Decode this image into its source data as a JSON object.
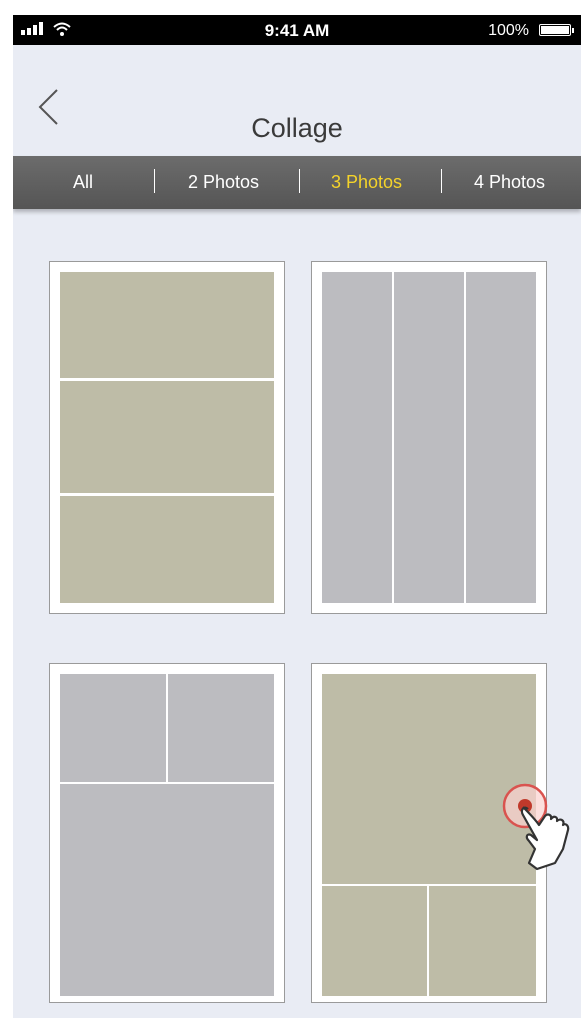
{
  "status_bar": {
    "time": "9:41 AM",
    "battery_text": "100%"
  },
  "header": {
    "title": "Collage",
    "back_icon": "chevron-left-icon"
  },
  "tabs": [
    {
      "label": "All",
      "active": false
    },
    {
      "label": "2 Photos",
      "active": false
    },
    {
      "label": "3 Photos",
      "active": true
    },
    {
      "label": "4 Photos",
      "active": false
    }
  ],
  "colors": {
    "active_tab": "#f4d32a",
    "olive_placeholder": "#bebca7",
    "gray_placeholder": "#bcbcc0",
    "background": "#e9ecf4"
  },
  "templates": [
    {
      "id": "three-horizontal-strips",
      "color": "olive"
    },
    {
      "id": "three-vertical-strips",
      "color": "gray"
    },
    {
      "id": "two-top-one-bottom",
      "color": "gray"
    },
    {
      "id": "one-top-two-bottom",
      "color": "olive"
    }
  ],
  "gesture": {
    "icon": "tap-hand-icon"
  }
}
